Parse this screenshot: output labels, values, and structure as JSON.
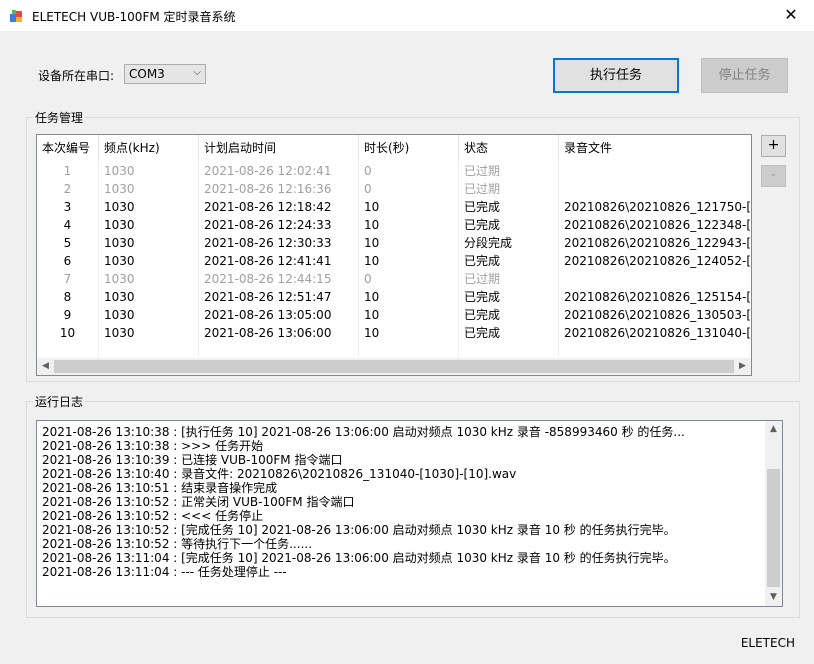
{
  "window": {
    "title": "ELETECH VUB-100FM 定时录音系统",
    "close_glyph": "✕"
  },
  "port": {
    "label": "设备所在串口:",
    "value": "COM3"
  },
  "buttons": {
    "execute": "执行任务",
    "stop": "停止任务",
    "add": "+",
    "remove": "-"
  },
  "tasks": {
    "group_title": "任务管理",
    "columns": [
      "本次编号",
      "频点(kHz)",
      "计划启动时间",
      "时长(秒)",
      "状态",
      "录音文件"
    ],
    "rows": [
      {
        "id": "1",
        "freq": "1030",
        "start": "2021-08-26 12:02:41",
        "duration": "0",
        "status": "已过期",
        "file": "",
        "gray": true
      },
      {
        "id": "2",
        "freq": "1030",
        "start": "2021-08-26 12:16:36",
        "duration": "0",
        "status": "已过期",
        "file": "",
        "gray": true
      },
      {
        "id": "3",
        "freq": "1030",
        "start": "2021-08-26 12:18:42",
        "duration": "10",
        "status": "已完成",
        "file": "20210826\\20210826_121750-[...",
        "gray": false
      },
      {
        "id": "4",
        "freq": "1030",
        "start": "2021-08-26 12:24:33",
        "duration": "10",
        "status": "已完成",
        "file": "20210826\\20210826_122348-[...",
        "gray": false
      },
      {
        "id": "5",
        "freq": "1030",
        "start": "2021-08-26 12:30:33",
        "duration": "10",
        "status": "分段完成",
        "file": "20210826\\20210826_122943-[...",
        "gray": false
      },
      {
        "id": "6",
        "freq": "1030",
        "start": "2021-08-26 12:41:41",
        "duration": "10",
        "status": "已完成",
        "file": "20210826\\20210826_124052-[...",
        "gray": false
      },
      {
        "id": "7",
        "freq": "1030",
        "start": "2021-08-26 12:44:15",
        "duration": "0",
        "status": "已过期",
        "file": "",
        "gray": true
      },
      {
        "id": "8",
        "freq": "1030",
        "start": "2021-08-26 12:51:47",
        "duration": "10",
        "status": "已完成",
        "file": "20210826\\20210826_125154-[...",
        "gray": false
      },
      {
        "id": "9",
        "freq": "1030",
        "start": "2021-08-26 13:05:00",
        "duration": "10",
        "status": "已完成",
        "file": "20210826\\20210826_130503-[...",
        "gray": false
      },
      {
        "id": "10",
        "freq": "1030",
        "start": "2021-08-26 13:06:00",
        "duration": "10",
        "status": "已完成",
        "file": "20210826\\20210826_131040-[...",
        "gray": false
      }
    ]
  },
  "log": {
    "group_title": "运行日志",
    "lines": [
      "2021-08-26 13:10:38 : [执行任务 10] 2021-08-26 13:06:00 启动对频点 1030 kHz 录音 -858993460 秒 的任务...",
      "2021-08-26 13:10:38 : >>> 任务开始",
      "2021-08-26 13:10:39 : 已连接 VUB-100FM 指令端口",
      "2021-08-26 13:10:40 : 录音文件: 20210826\\20210826_131040-[1030]-[10].wav",
      "2021-08-26 13:10:51 : 结束录音操作完成",
      "2021-08-26 13:10:52 : 正常关闭 VUB-100FM 指令端口",
      "2021-08-26 13:10:52 : <<< 任务停止",
      "2021-08-26 13:10:52 : [完成任务 10] 2021-08-26 13:06:00 启动对频点 1030 kHz 录音 10 秒 的任务执行完毕。",
      "2021-08-26 13:10:52 : 等待执行下一个任务......",
      "2021-08-26 13:11:04 : [完成任务 10] 2021-08-26 13:06:00 启动对频点 1030 kHz 录音 10 秒 的任务执行完毕。",
      "2021-08-26 13:11:04 : --- 任务处理停止 ---"
    ]
  },
  "footer": {
    "brand": "ELETECH"
  }
}
